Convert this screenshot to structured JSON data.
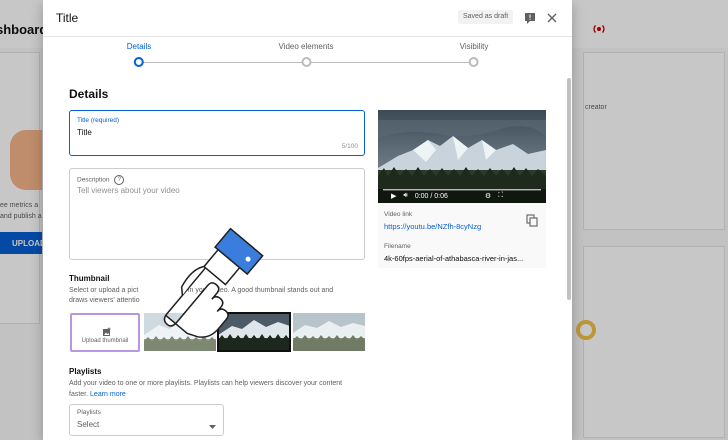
{
  "background": {
    "page_title": "shboard",
    "bg_text_1": "creator",
    "bg_text_2": "ee metrics a",
    "bg_text_3": "and publish a",
    "upload_button": "UPLOAD"
  },
  "modal": {
    "title": "Title",
    "saved_chip": "Saved as draft",
    "icons": {
      "feedback": "feedback-icon",
      "close": "close-icon",
      "live": "live-icon"
    },
    "stepper": [
      {
        "label": "Details",
        "active": true
      },
      {
        "label": "Video elements",
        "active": false
      },
      {
        "label": "Visibility",
        "active": false
      }
    ],
    "details_heading": "Details",
    "title_field": {
      "label": "Title (required)",
      "value": "Title",
      "counter": "5/100"
    },
    "description_field": {
      "label": "Description",
      "placeholder": "Tell viewers about your video"
    },
    "video_panel": {
      "time": "0:00 / 0:06",
      "link_label": "Video link",
      "link": "https://youtu.be/NZfh-8cyNzg",
      "filename_label": "Filename",
      "filename": "4k-60fps-aerial-of-athabasca-river-in-jas..."
    },
    "thumbnail": {
      "heading": "Thumbnail",
      "desc_line1": "Select or upload a pict",
      "desc_line1b": "in your video. A good thumbnail stands out and",
      "desc_line2": "draws viewers' attentio",
      "upload_label": "Upload thumbnail"
    },
    "playlists": {
      "heading": "Playlists",
      "desc_line1": "Add your video to one or more playlists. Playlists can help viewers discover your content",
      "desc_line2": "faster.",
      "learn_more": "Learn more",
      "select_label": "Playlists",
      "select_value": "Select"
    }
  }
}
